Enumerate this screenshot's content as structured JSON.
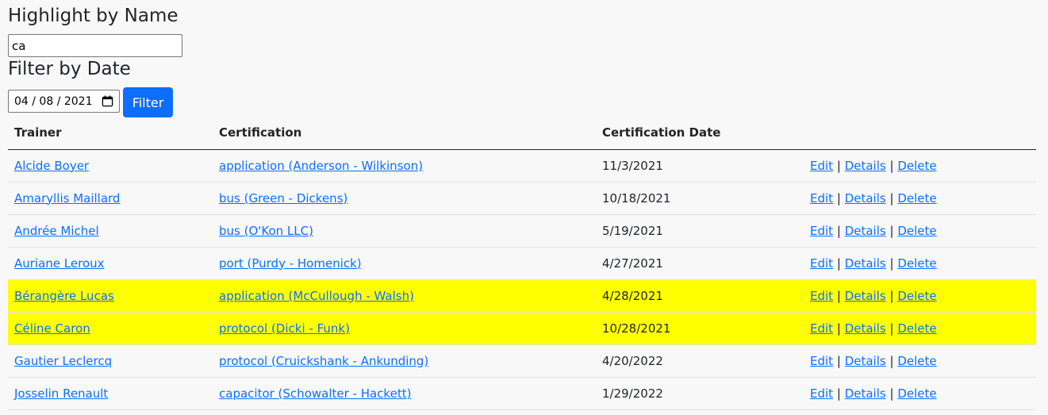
{
  "highlight": {
    "heading": "Highlight by Name",
    "value": "ca"
  },
  "filter": {
    "heading": "Filter by Date",
    "date": "04 / 08 / 2021",
    "button": "Filter"
  },
  "table": {
    "headers": [
      "Trainer",
      "Certification",
      "Certification Date",
      ""
    ],
    "action_labels": {
      "edit": "Edit",
      "details": "Details",
      "delete": "Delete",
      "sep": "|"
    },
    "rows": [
      {
        "trainer": "Alcide Boyer",
        "certification": "application (Anderson - Wilkinson)",
        "date": "11/3/2021",
        "highlighted": false
      },
      {
        "trainer": "Amaryllis Maillard",
        "certification": "bus (Green - Dickens)",
        "date": "10/18/2021",
        "highlighted": false
      },
      {
        "trainer": "Andrée Michel",
        "certification": "bus (O'Kon LLC)",
        "date": "5/19/2021",
        "highlighted": false
      },
      {
        "trainer": "Auriane Leroux",
        "certification": "port (Purdy - Homenick)",
        "date": "4/27/2021",
        "highlighted": false
      },
      {
        "trainer": "Bérangère Lucas",
        "certification": "application (McCullough - Walsh)",
        "date": "4/28/2021",
        "highlighted": true
      },
      {
        "trainer": "Céline Caron",
        "certification": "protocol (Dicki - Funk)",
        "date": "10/28/2021",
        "highlighted": true
      },
      {
        "trainer": "Gautier Leclercq",
        "certification": "protocol (Cruickshank - Ankunding)",
        "date": "4/20/2022",
        "highlighted": false
      },
      {
        "trainer": "Josselin Renault",
        "certification": "capacitor (Schowalter - Hackett)",
        "date": "1/29/2022",
        "highlighted": false
      }
    ]
  },
  "colors": {
    "highlight": "#ffff00",
    "link": "#0d6efd",
    "button": "#0d6efd"
  },
  "icons": {
    "date_picker": "calendar-icon"
  }
}
